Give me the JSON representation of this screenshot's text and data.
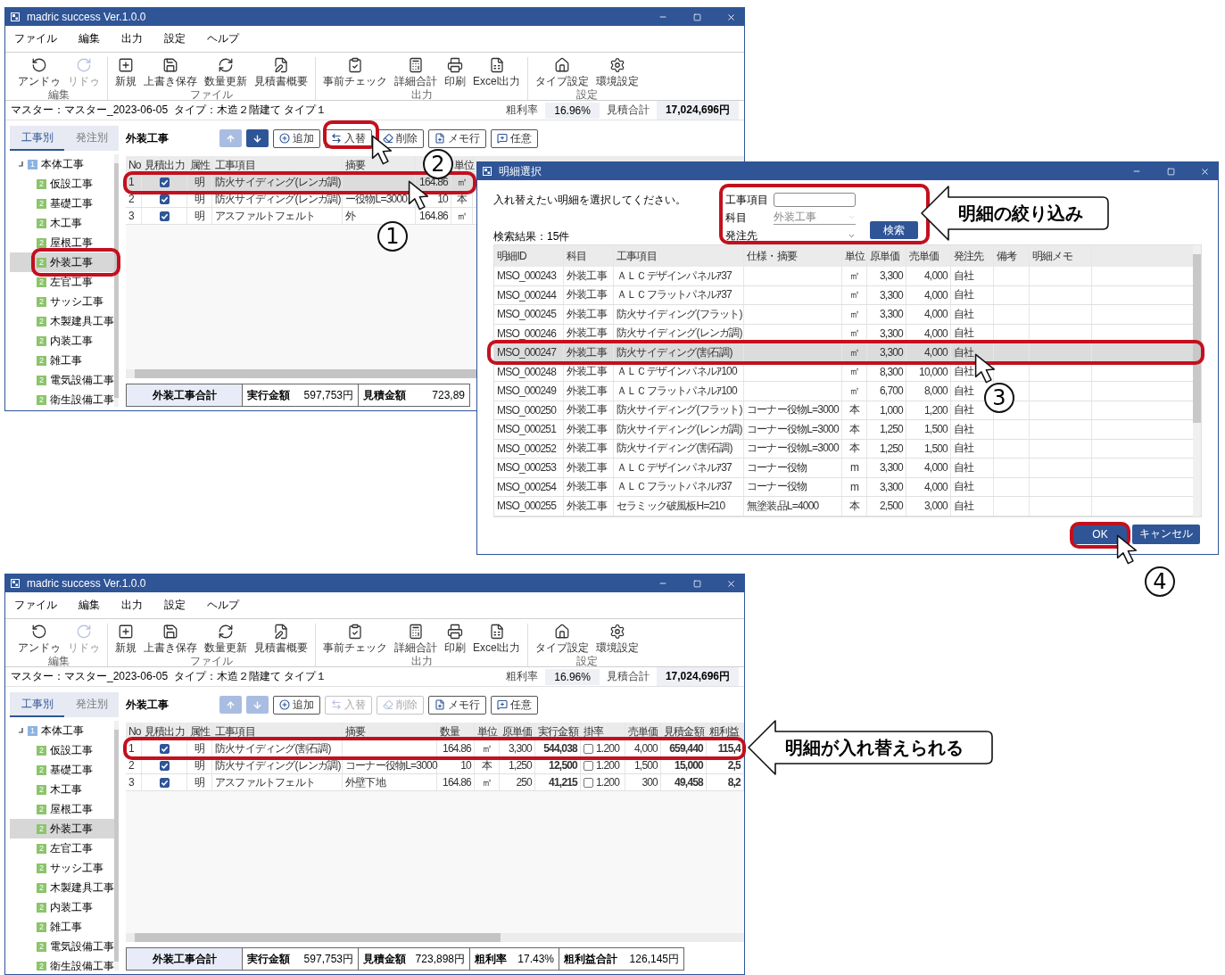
{
  "windows": [
    {
      "title": "madric success Ver.1.0.0",
      "menu": [
        "ファイル",
        "編集",
        "出力",
        "設定",
        "ヘルプ"
      ],
      "toolbar": [
        {
          "label": "編集",
          "items": [
            {
              "label": "アンドゥ",
              "disabled": false
            },
            {
              "label": "リドゥ",
              "disabled": true
            }
          ]
        },
        {
          "label": "ファイル",
          "items": [
            {
              "label": "新規",
              "disabled": false
            },
            {
              "label": "上書き保存",
              "disabled": false
            },
            {
              "label": "数量更新",
              "disabled": false
            },
            {
              "label": "見積書概要",
              "disabled": false
            }
          ]
        },
        {
          "label": "出力",
          "items": [
            {
              "label": "事前チェック",
              "disabled": false
            },
            {
              "label": "詳細合計",
              "disabled": false
            },
            {
              "label": "印刷",
              "disabled": false
            },
            {
              "label": "Excel出力",
              "disabled": false
            }
          ]
        },
        {
          "label": "設定",
          "items": [
            {
              "label": "タイプ設定",
              "disabled": false
            },
            {
              "label": "環境設定",
              "disabled": false
            }
          ]
        }
      ],
      "info": {
        "text": "マスター：マスター_2023-06-05  タイプ：木造２階建て タイプ１",
        "stats": [
          {
            "label": "粗利率",
            "value": "16.96%"
          },
          {
            "label": "見積合計",
            "value": "17,024,696円"
          }
        ]
      },
      "sidebar": {
        "tabs": [
          {
            "label": "工事別",
            "selected": true
          },
          {
            "label": "発注別",
            "selected": false
          }
        ],
        "tree": {
          "label": "本体工事",
          "badge": "1",
          "expanded": true,
          "selected": false,
          "children": [
            {
              "label": "仮設工事",
              "badge": "2",
              "selected": false
            },
            {
              "label": "基礎工事",
              "badge": "2",
              "selected": false
            },
            {
              "label": "木工事",
              "badge": "2",
              "selected": false
            },
            {
              "label": "屋根工事",
              "badge": "2",
              "selected": false
            },
            {
              "label": "外装工事",
              "badge": "2",
              "selected": true
            },
            {
              "label": "左官工事",
              "badge": "2",
              "selected": false
            },
            {
              "label": "サッシ工事",
              "badge": "2",
              "selected": false
            },
            {
              "label": "木製建具工事",
              "badge": "2",
              "selected": false
            },
            {
              "label": "内装工事",
              "badge": "2",
              "selected": false
            },
            {
              "label": "雑工事",
              "badge": "2",
              "selected": false
            },
            {
              "label": "電気設備工事",
              "badge": "2",
              "selected": false
            },
            {
              "label": "衛生設備工事",
              "badge": "2",
              "selected": false
            }
          ]
        }
      },
      "section_title": "外装工事",
      "actions": [
        {
          "kind": "up",
          "disabled": true
        },
        {
          "kind": "down",
          "disabled": false
        },
        {
          "kind": "add",
          "label": "追加",
          "disabled": false
        },
        {
          "kind": "replace",
          "label": "入替",
          "disabled": false
        },
        {
          "kind": "delete",
          "label": "削除",
          "disabled": false
        },
        {
          "kind": "memo",
          "label": "メモ行",
          "disabled": false
        },
        {
          "kind": "custom",
          "label": "任意",
          "disabled": false
        }
      ],
      "table": {
        "columns": [
          "No",
          "見積出力",
          "属性",
          "工事項目",
          "摘要",
          null,
          "単位"
        ],
        "rows": [
          {
            "selected": true,
            "cells": [
              "1",
              {
                "checked": true
              },
              "明",
              "防火サイディング(レンガ調)",
              null,
              "164.86",
              "㎡"
            ]
          },
          {
            "selected": false,
            "cells": [
              "2",
              {
                "checked": true
              },
              "明",
              "防火サイディング(レンガ調)",
              "ー役物L=3000",
              "10",
              "本"
            ]
          },
          {
            "selected": false,
            "cells": [
              "3",
              {
                "checked": true
              },
              "明",
              "アスファルトフェルト",
              "外",
              "164.86",
              "㎡"
            ]
          }
        ]
      },
      "footer": {
        "title": "外装工事合計",
        "items": [
          {
            "label": "実行金額",
            "value": "597,753円"
          },
          {
            "label": "見積金額",
            "value": "723,89"
          }
        ]
      }
    },
    {
      "title": "madric success Ver.1.0.0",
      "menu": [
        "ファイル",
        "編集",
        "出力",
        "設定",
        "ヘルプ"
      ],
      "toolbar": [
        {
          "label": "編集",
          "items": [
            {
              "label": "アンドゥ",
              "disabled": false
            },
            {
              "label": "リドゥ",
              "disabled": true
            }
          ]
        },
        {
          "label": "ファイル",
          "items": [
            {
              "label": "新規",
              "disabled": false
            },
            {
              "label": "上書き保存",
              "disabled": false
            },
            {
              "label": "数量更新",
              "disabled": false
            },
            {
              "label": "見積書概要",
              "disabled": false
            }
          ]
        },
        {
          "label": "出力",
          "items": [
            {
              "label": "事前チェック",
              "disabled": false
            },
            {
              "label": "詳細合計",
              "disabled": false
            },
            {
              "label": "印刷",
              "disabled": false
            },
            {
              "label": "Excel出力",
              "disabled": false
            }
          ]
        },
        {
          "label": "設定",
          "items": [
            {
              "label": "タイプ設定",
              "disabled": false
            },
            {
              "label": "環境設定",
              "disabled": false
            }
          ]
        }
      ],
      "info": {
        "text": "マスター：マスター_2023-06-05  タイプ：木造２階建て タイプ１",
        "stats": [
          {
            "label": "粗利率",
            "value": "16.96%"
          },
          {
            "label": "見積合計",
            "value": "17,024,696円"
          }
        ]
      },
      "sidebar": {
        "tabs": [
          {
            "label": "工事別",
            "selected": true
          },
          {
            "label": "発注別",
            "selected": false
          }
        ],
        "tree": {
          "label": "本体工事",
          "badge": "1",
          "expanded": true,
          "selected": false,
          "children": [
            {
              "label": "仮設工事",
              "badge": "2",
              "selected": false
            },
            {
              "label": "基礎工事",
              "badge": "2",
              "selected": false
            },
            {
              "label": "木工事",
              "badge": "2",
              "selected": false
            },
            {
              "label": "屋根工事",
              "badge": "2",
              "selected": false
            },
            {
              "label": "外装工事",
              "badge": "2",
              "selected": true
            },
            {
              "label": "左官工事",
              "badge": "2",
              "selected": false
            },
            {
              "label": "サッシ工事",
              "badge": "2",
              "selected": false
            },
            {
              "label": "木製建具工事",
              "badge": "2",
              "selected": false
            },
            {
              "label": "内装工事",
              "badge": "2",
              "selected": false
            },
            {
              "label": "雑工事",
              "badge": "2",
              "selected": false
            },
            {
              "label": "電気設備工事",
              "badge": "2",
              "selected": false
            },
            {
              "label": "衛生設備工事",
              "badge": "2",
              "selected": false
            }
          ]
        }
      },
      "section_title": "外装工事",
      "actions": [
        {
          "kind": "up",
          "disabled": true
        },
        {
          "kind": "down",
          "disabled": true
        },
        {
          "kind": "add",
          "label": "追加",
          "disabled": false
        },
        {
          "kind": "replace",
          "label": "入替",
          "disabled": true
        },
        {
          "kind": "delete",
          "label": "削除",
          "disabled": true
        },
        {
          "kind": "memo",
          "label": "メモ行",
          "disabled": false
        },
        {
          "kind": "custom",
          "label": "任意",
          "disabled": false
        }
      ],
      "table": {
        "columns": [
          "No",
          "見積出力",
          "属性",
          "工事項目",
          "摘要",
          "数量",
          "単位",
          "原単価",
          "実行金額",
          "掛率",
          "売単価",
          "見積金額",
          "粗利益"
        ],
        "rows": [
          {
            "selected": false,
            "cells": [
              "1",
              {
                "checked": true
              },
              "明",
              "防火サイディング(割石調)",
              null,
              "164.86",
              "㎡",
              "3,300",
              "544,038",
              {
                "checked": false,
                "text": "1.200"
              },
              "4,000",
              "659,440",
              "115,4"
            ]
          },
          {
            "selected": false,
            "cells": [
              "2",
              {
                "checked": true
              },
              "明",
              "防火サイディング(レンガ調)",
              "コーナー役物L=3000",
              "10",
              "本",
              "1,250",
              "12,500",
              {
                "checked": false,
                "text": "1.200"
              },
              "1,500",
              "15,000",
              "2,5"
            ]
          },
          {
            "selected": false,
            "cells": [
              "3",
              {
                "checked": true
              },
              "明",
              "アスファルトフェルト",
              "外壁下地",
              "164.86",
              "㎡",
              "250",
              "41,215",
              {
                "checked": false,
                "text": "1.200"
              },
              "300",
              "49,458",
              "8,2"
            ]
          }
        ]
      },
      "footer": {
        "title": "外装工事合計",
        "items": [
          {
            "label": "実行金額",
            "value": "597,753円"
          },
          {
            "label": "見積金額",
            "value": "723,898円"
          },
          {
            "label": "粗利率",
            "value": "17.43%"
          },
          {
            "label": "粗利益合計",
            "value": "126,145円"
          }
        ]
      }
    }
  ],
  "dialog": {
    "title": "明細選択",
    "instruction": "入れ替えたい明細を選択してください。",
    "filters": [
      {
        "kind": "text",
        "label": "工事項目"
      },
      {
        "kind": "select",
        "label": "科目",
        "value": "外装工事",
        "disabled": true
      },
      {
        "kind": "select",
        "label": "発注先",
        "disabled": false
      }
    ],
    "search_button": "検索",
    "result_count": "検索結果：15件",
    "columns": [
      "明細ID",
      "科目",
      "工事項目",
      "仕様・摘要",
      "単位",
      "原単価",
      "売単価",
      "発注先",
      "備考",
      "明細メモ"
    ],
    "rows": [
      {
        "selected": false,
        "cells": [
          "MSO_000243",
          "外装工事",
          "ＡＬＣデザインパネルｱ37",
          null,
          "㎡",
          "3,300",
          "4,000",
          "自社"
        ]
      },
      {
        "selected": false,
        "cells": [
          "MSO_000244",
          "外装工事",
          "ＡＬＣフラットパネルｱ37",
          null,
          "㎡",
          "3,300",
          "4,000",
          "自社"
        ]
      },
      {
        "selected": false,
        "cells": [
          "MSO_000245",
          "外装工事",
          "防火サイディング(フラット)",
          null,
          "㎡",
          "3,300",
          "4,000",
          "自社"
        ]
      },
      {
        "selected": false,
        "cells": [
          "MSO_000246",
          "外装工事",
          "防火サイディング(レンガ調)",
          null,
          "㎡",
          "3,300",
          "4,000",
          "自社"
        ]
      },
      {
        "selected": true,
        "cells": [
          "MSO_000247",
          "外装工事",
          "防火サイディング(割石調)",
          null,
          "㎡",
          "3,300",
          "4,000",
          "自社"
        ]
      },
      {
        "selected": false,
        "cells": [
          "MSO_000248",
          "外装工事",
          "ＡＬＣデザインパネルｱ100",
          null,
          "㎡",
          "8,300",
          "10,000",
          "自社"
        ]
      },
      {
        "selected": false,
        "cells": [
          "MSO_000249",
          "外装工事",
          "ＡＬＣフラットパネルｱ100",
          null,
          "㎡",
          "6,700",
          "8,000",
          "自社"
        ]
      },
      {
        "selected": false,
        "cells": [
          "MSO_000250",
          "外装工事",
          "防火サイディング(フラット)",
          "コーナー役物L=3000",
          "本",
          "1,000",
          "1,200",
          "自社"
        ]
      },
      {
        "selected": false,
        "cells": [
          "MSO_000251",
          "外装工事",
          "防火サイディング(レンガ調)",
          "コーナー役物L=3000",
          "本",
          "1,250",
          "1,500",
          "自社"
        ]
      },
      {
        "selected": false,
        "cells": [
          "MSO_000252",
          "外装工事",
          "防火サイディング(割石調)",
          "コーナー役物L=3000",
          "本",
          "1,250",
          "1,500",
          "自社"
        ]
      },
      {
        "selected": false,
        "cells": [
          "MSO_000253",
          "外装工事",
          "ＡＬＣデザインパネルｱ37",
          "コーナー役物",
          "m",
          "3,300",
          "4,000",
          "自社"
        ]
      },
      {
        "selected": false,
        "cells": [
          "MSO_000254",
          "外装工事",
          "ＡＬＣフラットパネルｱ37",
          "コーナー役物",
          "m",
          "3,300",
          "4,000",
          "自社"
        ]
      },
      {
        "selected": false,
        "cells": [
          "MSO_000255",
          "外装工事",
          "セラミック破風板H=210",
          "無塗装品L=4000",
          "本",
          "2,500",
          "3,000",
          "自社"
        ]
      }
    ],
    "buttons": [
      "OK",
      "キャンセル"
    ]
  },
  "markers": [
    {
      "label": "1"
    },
    {
      "label": "2"
    },
    {
      "label": "3"
    },
    {
      "label": "4"
    }
  ],
  "callouts": [
    {
      "text": "明細の絞り込み"
    },
    {
      "text": "明細が入れ替えられる"
    }
  ]
}
